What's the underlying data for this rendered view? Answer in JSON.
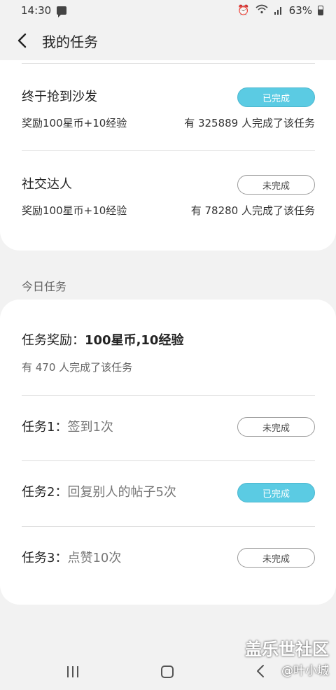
{
  "status_bar": {
    "time": "14:30",
    "battery": "63%"
  },
  "header": {
    "title": "我的任务"
  },
  "top_tasks": [
    {
      "name": "终于抢到沙发",
      "reward": "奖励100星币+10经验",
      "count": "有 325889 人完成了该任务",
      "status": "已完成",
      "done": true
    },
    {
      "name": "社交达人",
      "reward": "奖励100星币+10经验",
      "count": "有 78280 人完成了该任务",
      "status": "未完成",
      "done": false
    }
  ],
  "today": {
    "section_label": "今日任务",
    "reward_label": "任务奖励：",
    "reward_value": "100星币,10经验",
    "count": "有 470 人完成了该任务",
    "tasks": [
      {
        "label": "任务1：",
        "desc": "签到1次",
        "status": "未完成",
        "done": false
      },
      {
        "label": "任务2：",
        "desc": "回复别人的帖子5次",
        "status": "已完成",
        "done": true
      },
      {
        "label": "任务3：",
        "desc": "点赞10次",
        "status": "未完成",
        "done": false
      }
    ]
  },
  "watermark": {
    "title": "盖乐世社区",
    "author": "@叶小城"
  },
  "icons": {
    "back": "back-arrow-icon",
    "message": "message-icon",
    "alarm": "alarm-icon",
    "wifi": "wifi-icon",
    "signal": "signal-icon",
    "battery": "battery-icon"
  },
  "colors": {
    "done_pill": "#5bcbe3",
    "background": "#f2f2f2"
  }
}
